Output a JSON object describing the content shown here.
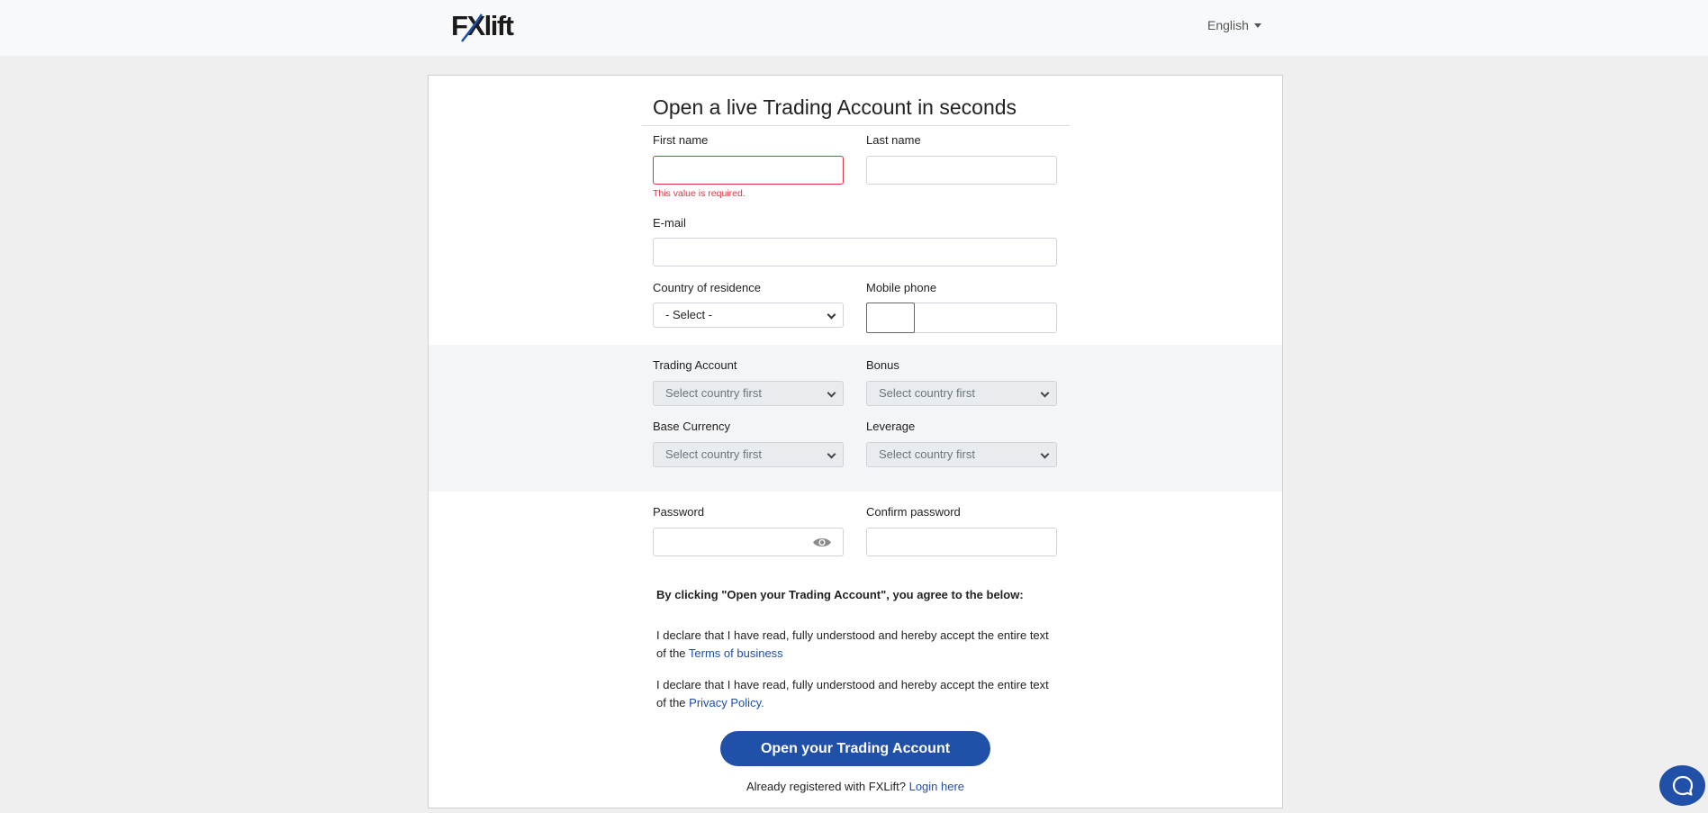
{
  "header": {
    "logo_text_1": "F",
    "logo_text_2": "X",
    "logo_text_3": "lift",
    "language": "English"
  },
  "form": {
    "title": "Open a live Trading Account in seconds",
    "first_name": {
      "label": "First name",
      "value": "",
      "error": "This value is required."
    },
    "last_name": {
      "label": "Last name",
      "value": ""
    },
    "email": {
      "label": "E-mail",
      "value": ""
    },
    "country": {
      "label": "Country of residence",
      "selected": "- Select -"
    },
    "mobile": {
      "label": "Mobile phone",
      "code": "",
      "value": ""
    },
    "trading_account": {
      "label": "Trading Account",
      "selected": "Select country first"
    },
    "bonus": {
      "label": "Bonus",
      "selected": "Select country first"
    },
    "base_currency": {
      "label": "Base Currency",
      "selected": "Select country first"
    },
    "leverage": {
      "label": "Leverage",
      "selected": "Select country first"
    },
    "password": {
      "label": "Password",
      "value": ""
    },
    "confirm_password": {
      "label": "Confirm password",
      "value": ""
    }
  },
  "agreement": {
    "heading": "By clicking \"Open your Trading Account\", you agree to the below:",
    "terms_text": "I declare that I have read, fully understood and hereby accept the entire text of the",
    "terms_link": "Terms of business",
    "privacy_text": "I declare that I have read, fully understood and hereby accept the entire text of the",
    "privacy_link": "Privacy Policy."
  },
  "submit_label": "Open your Trading Account",
  "login": {
    "text": "Already registered with FXLift?",
    "link": "Login here"
  },
  "colors": {
    "brand_blue": "#2150a8",
    "error_red": "#dc3545"
  },
  "icons": [
    "eye-icon",
    "chevron-down-icon",
    "chat-icon"
  ]
}
